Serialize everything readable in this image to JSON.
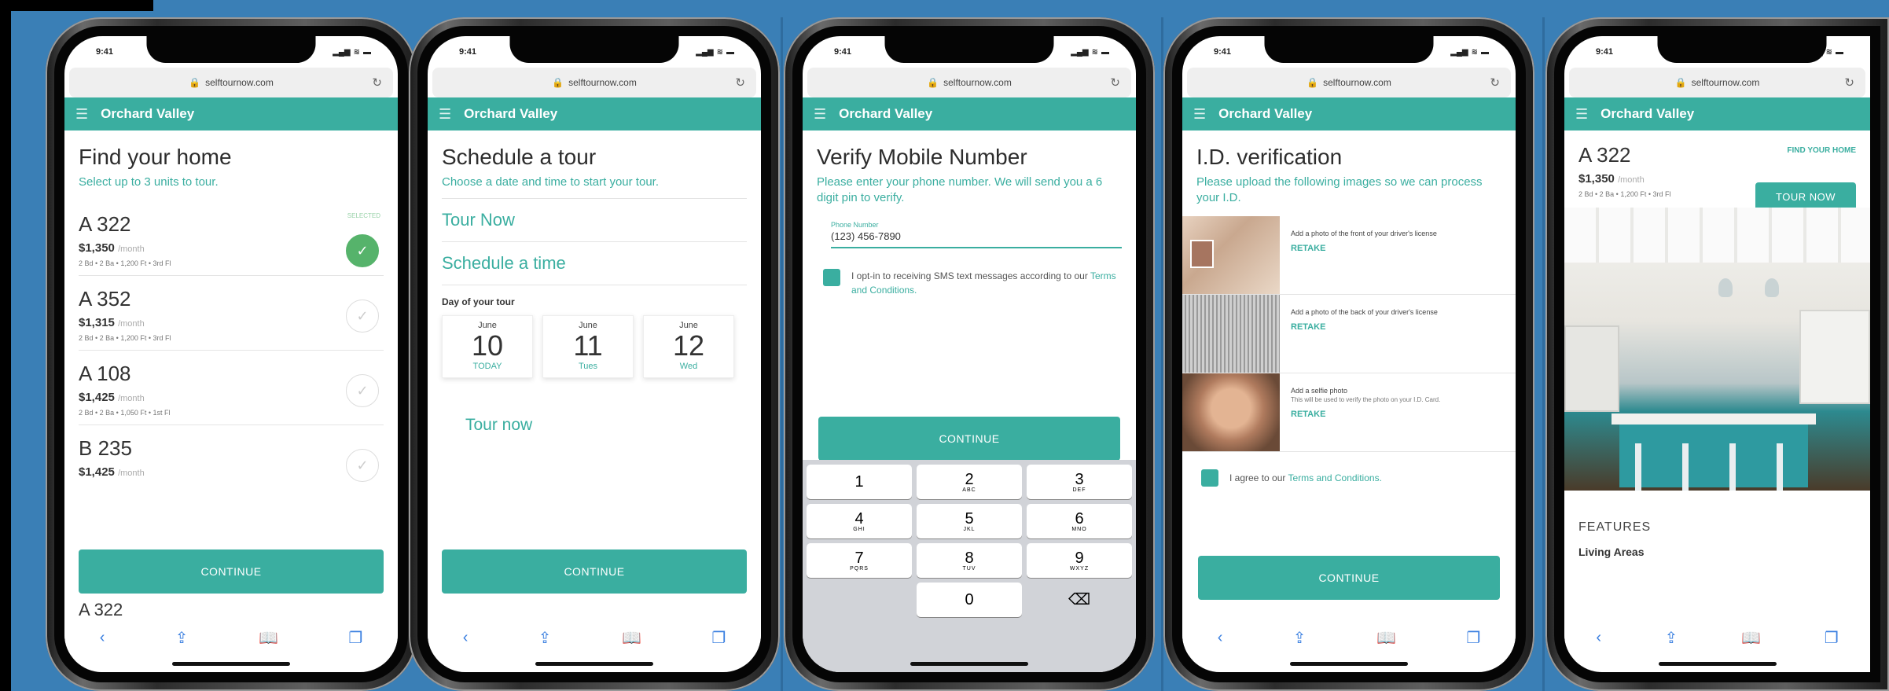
{
  "status_time": "9:41",
  "url": "selftournow.com",
  "nav_title": "Orchard Valley",
  "screen1": {
    "title": "Find your home",
    "subtitle": "Select up to 3 units to tour.",
    "selected_label": "SELECTED",
    "units": [
      {
        "name": "A 322",
        "price": "$1,350",
        "per": "/month",
        "specs": "2 Bd • 2 Ba • 1,200 Ft • 3rd Fl",
        "selected": true
      },
      {
        "name": "A 352",
        "price": "$1,315",
        "per": "/month",
        "specs": "2 Bd • 2 Ba • 1,200 Ft • 3rd Fl",
        "selected": false
      },
      {
        "name": "A 108",
        "price": "$1,425",
        "per": "/month",
        "specs": "2 Bd • 2 Ba • 1,050 Ft • 1st Fl",
        "selected": false
      },
      {
        "name": "B 235",
        "price": "$1,425",
        "per": "/month",
        "specs": "",
        "selected": false
      }
    ],
    "peek_unit": "A 322",
    "continue": "CONTINUE"
  },
  "screen2": {
    "title": "Schedule a tour",
    "subtitle": "Choose a date and time to start your tour.",
    "opt1": "Tour Now",
    "opt2": "Schedule a time",
    "day_label": "Day of your tour",
    "days": [
      {
        "month": "June",
        "date": "10",
        "weekday": "TODAY"
      },
      {
        "month": "June",
        "date": "11",
        "weekday": "Tues"
      },
      {
        "month": "June",
        "date": "12",
        "weekday": "Wed"
      }
    ],
    "tour_now": "Tour now",
    "continue": "CONTINUE"
  },
  "screen3": {
    "title": "Verify Mobile Number",
    "subtitle": "Please enter your phone number. We will send you a 6 digit pin to verify.",
    "field_label": "Phone Number",
    "field_value": "(123) 456-7890",
    "optin_text": "I opt-in to receiving SMS text messages according to our",
    "optin_link": "Terms and Conditions.",
    "continue": "CONTINUE",
    "keys": [
      {
        "n": "1",
        "l": ""
      },
      {
        "n": "2",
        "l": "ABC"
      },
      {
        "n": "3",
        "l": "DEF"
      },
      {
        "n": "4",
        "l": "GHI"
      },
      {
        "n": "5",
        "l": "JKL"
      },
      {
        "n": "6",
        "l": "MNO"
      },
      {
        "n": "7",
        "l": "PQRS"
      },
      {
        "n": "8",
        "l": "TUV"
      },
      {
        "n": "9",
        "l": "WXYZ"
      },
      {
        "n": "",
        "l": ""
      },
      {
        "n": "0",
        "l": ""
      },
      {
        "n": "⌫",
        "l": ""
      }
    ]
  },
  "screen4": {
    "title": "I.D. verification",
    "subtitle": "Please upload the following images so we can process your I.D.",
    "rows": [
      {
        "text": "Add a photo of the front of your driver's license",
        "note": "",
        "action": "RETAKE"
      },
      {
        "text": "Add a photo of the back of your driver's license",
        "note": "",
        "action": "RETAKE"
      },
      {
        "text": "Add a selfie photo",
        "note": "This will be used to verify the photo on your I.D. Card.",
        "action": "RETAKE"
      }
    ],
    "agree_text": "I agree to our",
    "agree_link": "Terms and Conditions.",
    "continue": "CONTINUE"
  },
  "screen5": {
    "unit": "A 322",
    "find_link": "FIND YOUR HOME",
    "price": "$1,350",
    "per": "/month",
    "specs": "2 Bd • 2 Ba • 1,200 Ft • 3rd Fl",
    "tour_now": "TOUR NOW",
    "features": "FEATURES",
    "living": "Living Areas"
  },
  "icons": {
    "share": "share-icon",
    "bookmarks": "bookmarks-icon",
    "tabs": "tabs-icon",
    "back": "back-icon"
  },
  "colors": {
    "teal": "#3aaea0",
    "background": "#3a7fb6",
    "selected_green": "#56b36b"
  }
}
